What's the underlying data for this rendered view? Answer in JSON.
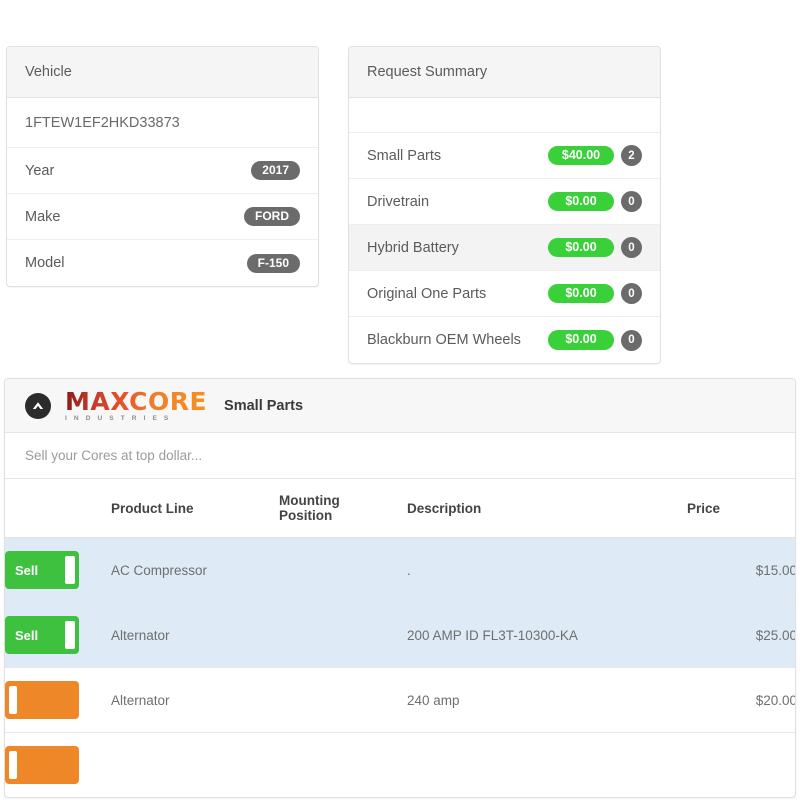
{
  "vehicle_card": {
    "title": "Vehicle",
    "vin": "1FTEW1EF2HKD33873",
    "fields": [
      {
        "label": "Year",
        "value": "2017"
      },
      {
        "label": "Make",
        "value": "FORD"
      },
      {
        "label": "Model",
        "value": "F-150"
      }
    ]
  },
  "summary_card": {
    "title": "Request Summary",
    "rows": [
      {
        "label": "Small Parts",
        "amount": "$40.00",
        "count": "2"
      },
      {
        "label": "Drivetrain",
        "amount": "$0.00",
        "count": "0"
      },
      {
        "label": "Hybrid Battery",
        "amount": "$0.00",
        "count": "0"
      },
      {
        "label": "Original One Parts",
        "amount": "$0.00",
        "count": "0"
      },
      {
        "label": "Blackburn OEM Wheels",
        "amount": "$0.00",
        "count": "0"
      }
    ]
  },
  "parts_panel": {
    "logo_main": "MAXCORE",
    "logo_sub": "INDUSTRIES",
    "title": "Small Parts",
    "tagline": "Sell your Cores at top dollar...",
    "columns": {
      "action": "",
      "product_line": "Product Line",
      "mounting_position_line1": "Mounting",
      "mounting_position_line2": "Position",
      "description": "Description",
      "price": "Price"
    },
    "rows": [
      {
        "button_label": "Sell",
        "button_state": "green",
        "product_line": "AC Compressor",
        "mounting_position": "",
        "description": ".",
        "price": "$15.00",
        "selected": true
      },
      {
        "button_label": "Sell",
        "button_state": "green",
        "product_line": "Alternator",
        "mounting_position": "",
        "description": "200 AMP ID FL3T-10300-KA",
        "price": "$25.00",
        "selected": true
      },
      {
        "button_label": "",
        "button_state": "orange",
        "product_line": "Alternator",
        "mounting_position": "",
        "description": "240 amp",
        "price": "$20.00",
        "selected": false
      },
      {
        "button_label": "",
        "button_state": "orange",
        "product_line": "",
        "mounting_position": "",
        "description": "",
        "price": "",
        "selected": false
      }
    ]
  },
  "colors": {
    "green_badge": "#3ad03a",
    "gray_badge": "#6b6b6b",
    "row_selected": "#deeaf5",
    "button_green": "#3ec13e",
    "button_orange": "#ee8727",
    "logo_red": "#c0392b",
    "logo_orange": "#f6931e"
  }
}
